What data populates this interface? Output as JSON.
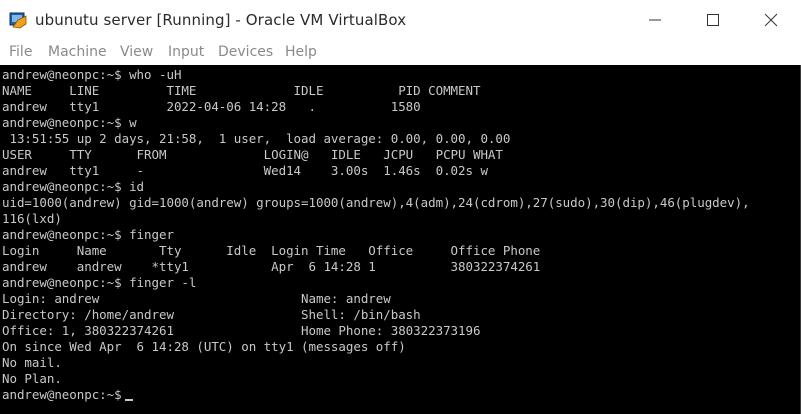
{
  "window": {
    "title": "ubunutu server [Running] - Oracle VM VirtualBox"
  },
  "menu": [
    "File",
    "Machine",
    "View",
    "Input",
    "Devices",
    "Help"
  ],
  "terminal": {
    "lines": [
      "andrew@neonpc:~$ who -uH",
      "NAME     LINE         TIME             IDLE          PID COMMENT",
      "andrew   tty1         2022-04-06 14:28   .          1580",
      "andrew@neonpc:~$ w",
      " 13:51:55 up 2 days, 21:58,  1 user,  load average: 0.00, 0.00, 0.00",
      "USER     TTY      FROM             LOGIN@   IDLE   JCPU   PCPU WHAT",
      "andrew   tty1     -                Wed14    3.00s  1.46s  0.02s w",
      "andrew@neonpc:~$ id",
      "uid=1000(andrew) gid=1000(andrew) groups=1000(andrew),4(adm),24(cdrom),27(sudo),30(dip),46(plugdev),",
      "116(lxd)",
      "andrew@neonpc:~$ finger",
      "Login     Name       Tty      Idle  Login Time   Office     Office Phone",
      "andrew    andrew    *tty1           Apr  6 14:28 1          380322374261",
      "andrew@neonpc:~$ finger -l",
      "Login: andrew                           Name: andrew",
      "Directory: /home/andrew                 Shell: /bin/bash",
      "Office: 1, 380322374261                 Home Phone: 380322373196",
      "On since Wed Apr  6 14:28 (UTC) on tty1 (messages off)",
      "No mail.",
      "No Plan.",
      "andrew@neonpc:~$"
    ]
  },
  "colors": {
    "terminal_bg": "#000000",
    "terminal_fg": "#c8c8c8",
    "menu_text": "#8a8a8a",
    "title_text": "#2b2b2b"
  }
}
